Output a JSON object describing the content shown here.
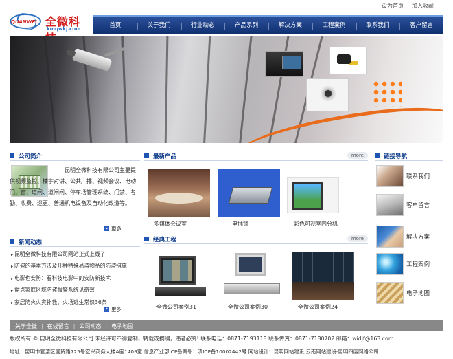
{
  "toplinks": {
    "set_home": "设为首页",
    "add_fav": "加入收藏"
  },
  "logo": {
    "en": "QUANWEI",
    "cn": "全微科技",
    "domain": "kmqwkj.com"
  },
  "nav": [
    "首页",
    "关于我们",
    "行业动态",
    "产品系列",
    "解决方案",
    "工程案例",
    "联系我们",
    "客户留言"
  ],
  "intro": {
    "title": "公司简介",
    "text": "昆明全微科技有限公司主要提供视频监控、楼宇对讲、公共广播、视频会议、电动门、窗、道闸、道闸闸、停车场管理系统、门禁、考勤、收费、巡更、普通机电设备及自动化改造等。",
    "more": "更多"
  },
  "products": {
    "title": "最新产品",
    "more": "more",
    "items": [
      "多媒体会议室",
      "电插锁",
      "彩色可视室内分机"
    ]
  },
  "news": {
    "title": "新闻动态",
    "more": "更多",
    "items": [
      "昆明全微科技有限公司网站正式上线了",
      "防盗的基本方法及几种特殊易盗物品的防盗措施",
      "电影也安防：看科技电影中的安防新技术",
      "盘点家庭区域防盗报警系统见奇效",
      "家居防火火灾扑救、火场逃生常识36条"
    ]
  },
  "cases": {
    "title": "经典工程",
    "more": "more",
    "items": [
      "全微公司案例31",
      "全微公司案例30",
      "全微公司案例24"
    ]
  },
  "links": {
    "title": "链接导航",
    "items": [
      "联系我们",
      "客户留言",
      "解决方案",
      "工程案例",
      "电子地图"
    ]
  },
  "footer": {
    "nav": [
      "关于全微",
      "在线留言",
      "公司动态",
      "电子地图"
    ],
    "copyright": "版权所有 © 昆明全微科技有限公司 未经许可不得复制、转载或摘编，违者必究! 联系电话：0871-7193118 联系传真：0871-7180702 邮箱：widjf@163.com",
    "address": "地址：昆明市官渡区国贸路725号宏兴商务大楼A座1409室 信息产业部ICP备案号：滇ICP备10002442号 网站设计：昆明网站建设,云南网站建设-昆明四度网络公司"
  }
}
